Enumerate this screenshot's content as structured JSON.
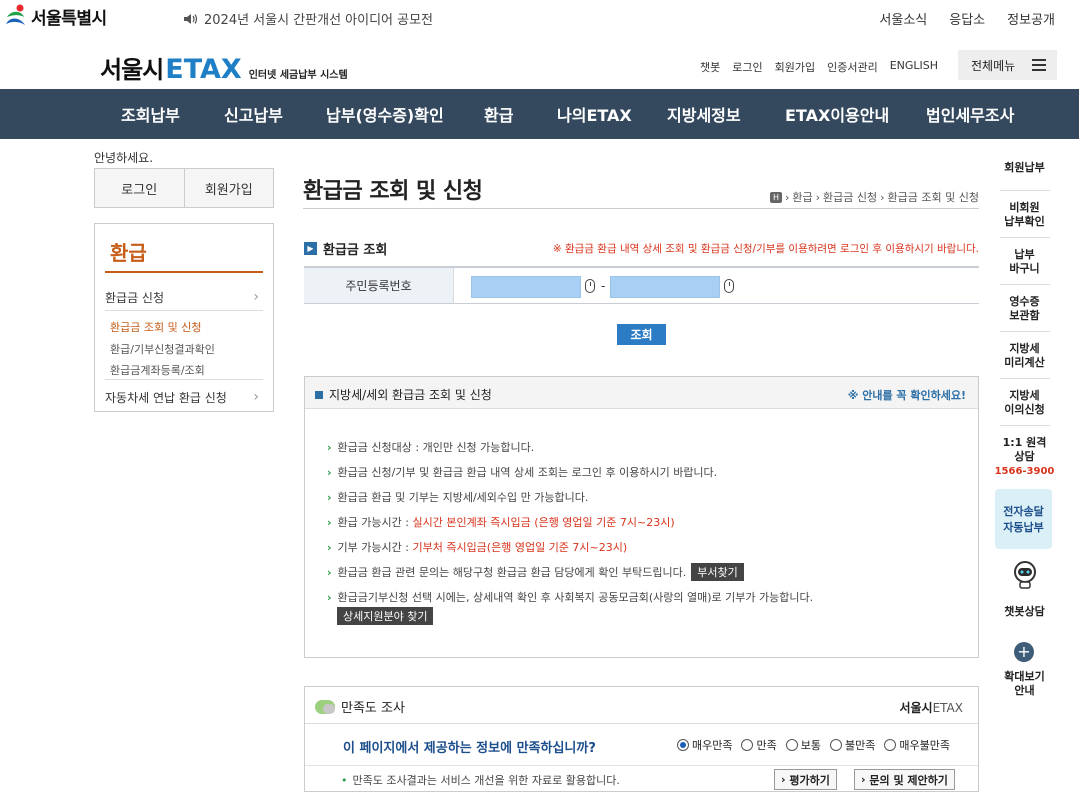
{
  "topbar": {
    "logo_text": "서울특별시",
    "notice": "2024년 서울시 간판개선 아이디어 공모전",
    "links": [
      "서울소식",
      "응답소",
      "정보공개"
    ]
  },
  "header": {
    "logo_seoul": "서울시",
    "logo_etax": "ETAX",
    "logo_sub": "인터넷 세금납부 시스템",
    "util_links": [
      "챗봇",
      "로그인",
      "회원가입",
      "인증서관리",
      "ENGLISH"
    ],
    "all_menu": "전체메뉴"
  },
  "gnb": [
    "조회납부",
    "신고납부",
    "납부(영수증)확인",
    "환급",
    "나의ETAX",
    "지방세정보",
    "ETAX이용안내",
    "법인세무조사"
  ],
  "left": {
    "greeting": "안녕하세요.",
    "login": "로그인",
    "join": "회원가입",
    "lnb_title": "환급",
    "item1": "환급금 신청",
    "sub1": "환급금 조회 및 신청",
    "sub2": "환급/기부신청결과확인",
    "sub3": "환급금계좌등록/조회",
    "item2": "자동차세 연납 환급 신청"
  },
  "main": {
    "title": "환급금 조회 및 신청",
    "breadcrumb": [
      "환급",
      "환급금 신청",
      "환급금 조회 및 신청"
    ],
    "section_title": "환급금 조회",
    "section_notice": "※ 환급금 환급 내역 상세 조회 및 환급금 신청/기부를 이용하려면 로그인 후 이용하시기 바랍니다.",
    "id_label": "주민등록번호",
    "dash": "-",
    "search_button": "조회",
    "info_title": "지방세/세외 환급금 조회 및 신청",
    "info_note": "※ 안내를 꼭 확인하세요!",
    "info1": "환급금 신청대상 : 개인만 신청 가능합니다.",
    "info2": "환급금 신청/기부 및 환급금 환급 내역 상세 조회는 로그인 후 이용하시기 바랍니다.",
    "info3": "환급금 환급 및 기부는 지방세/세외수입 만 가능합니다.",
    "info4_label": "환급 가능시간 : ",
    "info4_value": "실시간 본인계좌 즉시입금 (은행 영업일 기준 7시~23시)",
    "info5_label": "기부 가능시간 : ",
    "info5_value": "기부처 즉시입금(은행 영업일 기준 7시~23시)",
    "info6": "환급금 환급 관련 문의는 해당구청 환급금 환급 담당에게 확인 부탁드립니다.",
    "info6_btn": "부서찾기",
    "info7": "환급금기부신청 선택 시에는, 상세내역 확인 후 사회복지 공동모금회(사랑의 열매)로 기부가 가능합니다.",
    "info7_btn": "상세지원분야 찾기"
  },
  "survey": {
    "title": "만족도 조사",
    "brand_a": "서울시",
    "brand_b": "ETAX",
    "question": "이 페이지에서 제공하는 정보에 만족하십니까?",
    "options": [
      "매우만족",
      "만족",
      "보통",
      "불만족",
      "매우불만족"
    ],
    "selected": "매우만족",
    "note": "만족도 조사결과는 서비스 개선을 위한 자료로 활용합니다.",
    "rate_button": "평가하기",
    "inquiry_button": "문의 및 제안하기"
  },
  "quick": {
    "q1": "회원납부",
    "q2a": "비회원",
    "q2b": "납부확인",
    "q3a": "납부",
    "q3b": "바구니",
    "q4a": "영수증",
    "q4b": "보관함",
    "q5a": "지방세",
    "q5b": "미리계산",
    "q6a": "지방세",
    "q6b": "이의신청",
    "q7a": "1:1 원격",
    "q7b": "상담",
    "q7_phone": "1566-3900",
    "q8a": "전자송달",
    "q8b": "자동납부",
    "q9": "챗봇상담",
    "q10a": "확대보기",
    "q10b": "안내"
  },
  "colors": {
    "gnb_bg": "#34495e",
    "etax_blue": "#1e7fc6",
    "accent_orange": "#c75d19",
    "notice_red": "#d9331b",
    "button_blue": "#2b7bc5"
  }
}
